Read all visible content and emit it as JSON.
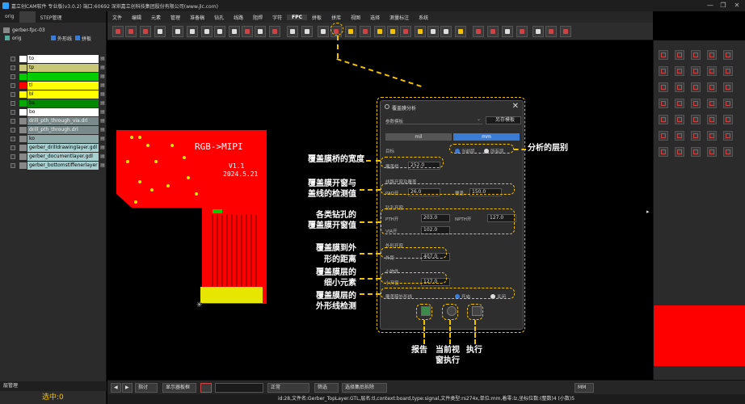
{
  "window": {
    "title": "嘉立创CAM软件 专业版(v3.0.2) 端口:60692    深圳嘉立创科技集团股份有限公司(www.jlc.com)",
    "min": "—",
    "max": "❐",
    "close": "✕"
  },
  "left": {
    "tabs": [
      "orig",
      "",
      "STEP管理"
    ],
    "job": "gerber-fpc-03",
    "step": "orig",
    "opt1": "外形线",
    "opt2": "拼板",
    "layers": [
      {
        "name": "to",
        "color": "#ffffff",
        "bg": "#ffffff",
        "fg": "#000000"
      },
      {
        "name": "tp",
        "color": "#c8c878",
        "bg": "#c8c878",
        "fg": "#000000"
      },
      {
        "name": "",
        "color": "#00cc00",
        "bg": "#00cc00",
        "fg": "#000000"
      },
      {
        "name": "tl",
        "color": "#ff0000",
        "bg": "#ffff00",
        "fg": "#000000"
      },
      {
        "name": "bl",
        "color": "#ffff00",
        "bg": "#ffff00",
        "fg": "#000000"
      },
      {
        "name": "bs",
        "color": "#00aa00",
        "bg": "#008800",
        "fg": "#000000"
      },
      {
        "name": "bo",
        "color": "#ffffff",
        "bg": "#ffffff",
        "fg": "#000000"
      },
      {
        "name": "drill_pth_through_via.drl",
        "color": "#888888",
        "bg": "#7a8a8a",
        "fg": "#eeeeee"
      },
      {
        "name": "drill_pth_through.drl",
        "color": "#888888",
        "bg": "#7a8a8a",
        "fg": "#eeeeee"
      },
      {
        "name": "ko",
        "color": "#888888",
        "bg": "#8fa8a8",
        "fg": "#000000"
      },
      {
        "name": "gerber_drilldrawinglayer.gdl",
        "color": "#888888",
        "bg": "#a8d0d0",
        "fg": "#000000"
      },
      {
        "name": "gerber_documentlayer.gdl",
        "color": "#888888",
        "bg": "#a8d0d0",
        "fg": "#000000"
      },
      {
        "name": "gerber_bottomstiffenerlayer",
        "color": "#888888",
        "bg": "#a8d0d0",
        "fg": "#000000"
      }
    ],
    "footer_tab": "层管理",
    "selected": "选中:0"
  },
  "menus": [
    "文件",
    "编辑",
    "元素",
    "管理",
    "准备稿",
    "钻孔",
    "线路",
    "阻焊",
    "字符",
    "FPC",
    "拼板",
    "拼库",
    "视图",
    "选择",
    "测量标注",
    "系统"
  ],
  "menu_selected": "FPC",
  "dialog": {
    "title": "覆盖膜分析",
    "template_label": "参数模板",
    "save_template": "另存模板",
    "unit_mil": "mil",
    "unit_mm": "mm",
    "target_label": "目标",
    "radio_current": "当前层",
    "radio_all": "所有层",
    "bridge_label": "覆盖桥",
    "bridge_value": "252.0",
    "pad_section": "线路开窗及覆盖",
    "pad_label": "PAD开",
    "pad_value": "26.0",
    "cover_label": "覆盖",
    "cover_value": "150.0",
    "drill_section": "钻孔开窗",
    "pth_label": "PTH开",
    "pth_value": "203.0",
    "npth_label": "NPTH开",
    "npth_value": "127.0",
    "via_label": "VIA开",
    "via_value": "102.0",
    "outline_section": "外形开窗",
    "outline_label": "外距",
    "outline_value": "407.0",
    "small_section": "小物件",
    "small_label": "小开窗",
    "small_value": "127.0",
    "check_label": "覆盖膜外形线",
    "check_on": "开启",
    "check_off": "关闭"
  },
  "annotations": {
    "layer_scope": "分析的层别",
    "bridge": "覆盖膜桥的宽度",
    "window1": "覆盖膜开窗与",
    "window2": "盖线的检测值",
    "drill1": "各类钻孔的",
    "drill2": "覆盖膜开窗值",
    "outline1": "覆盖膜到外",
    "outline2": "形的距离",
    "small1": "覆盖膜层的",
    "small2": "细小元素",
    "outline3": "覆盖膜层的",
    "outline4": "外形线检测",
    "report": "报告",
    "view1": "当前视",
    "view2": "窗执行",
    "execute": "执行"
  },
  "pcb": {
    "label1": "RGB->MIPI",
    "label2": "V1.1",
    "label3": "2024.5.21"
  },
  "status": {
    "zoom_mode": "指讨",
    "show_board": "显示器板框",
    "mode": "正常",
    "all": "筛选",
    "filter_tag": "选择集后拆除",
    "unit": "MM"
  },
  "info": "id:28,文件名:Gerber_TopLayer.GTL,层名:tl,context:board,type:signal,文件类型:rs274x,单位:mm,着零:lz,坐标位数:(整数)4 (小数)5"
}
